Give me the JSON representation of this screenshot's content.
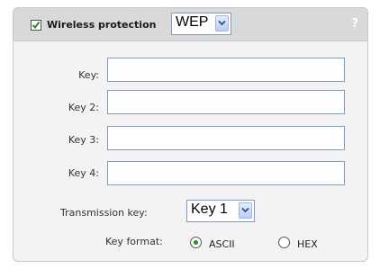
{
  "header": {
    "checkbox_checked": true,
    "title": "Wireless protection",
    "protection_select": "WEP",
    "help": "?"
  },
  "fields": [
    {
      "label": "Key:",
      "value": ""
    },
    {
      "label": "Key 2:",
      "value": ""
    },
    {
      "label": "Key 3:",
      "value": ""
    },
    {
      "label": "Key 4:",
      "value": ""
    }
  ],
  "transmission": {
    "label": "Transmission key:",
    "value": "Key 1"
  },
  "key_format": {
    "label": "Key format:",
    "options": [
      "ASCII",
      "HEX"
    ],
    "selected": "ASCII"
  },
  "colors": {
    "header_bg": "#d9d9d9",
    "panel_bg": "#f3f3f3",
    "check_mark": "#2a8a2a"
  }
}
